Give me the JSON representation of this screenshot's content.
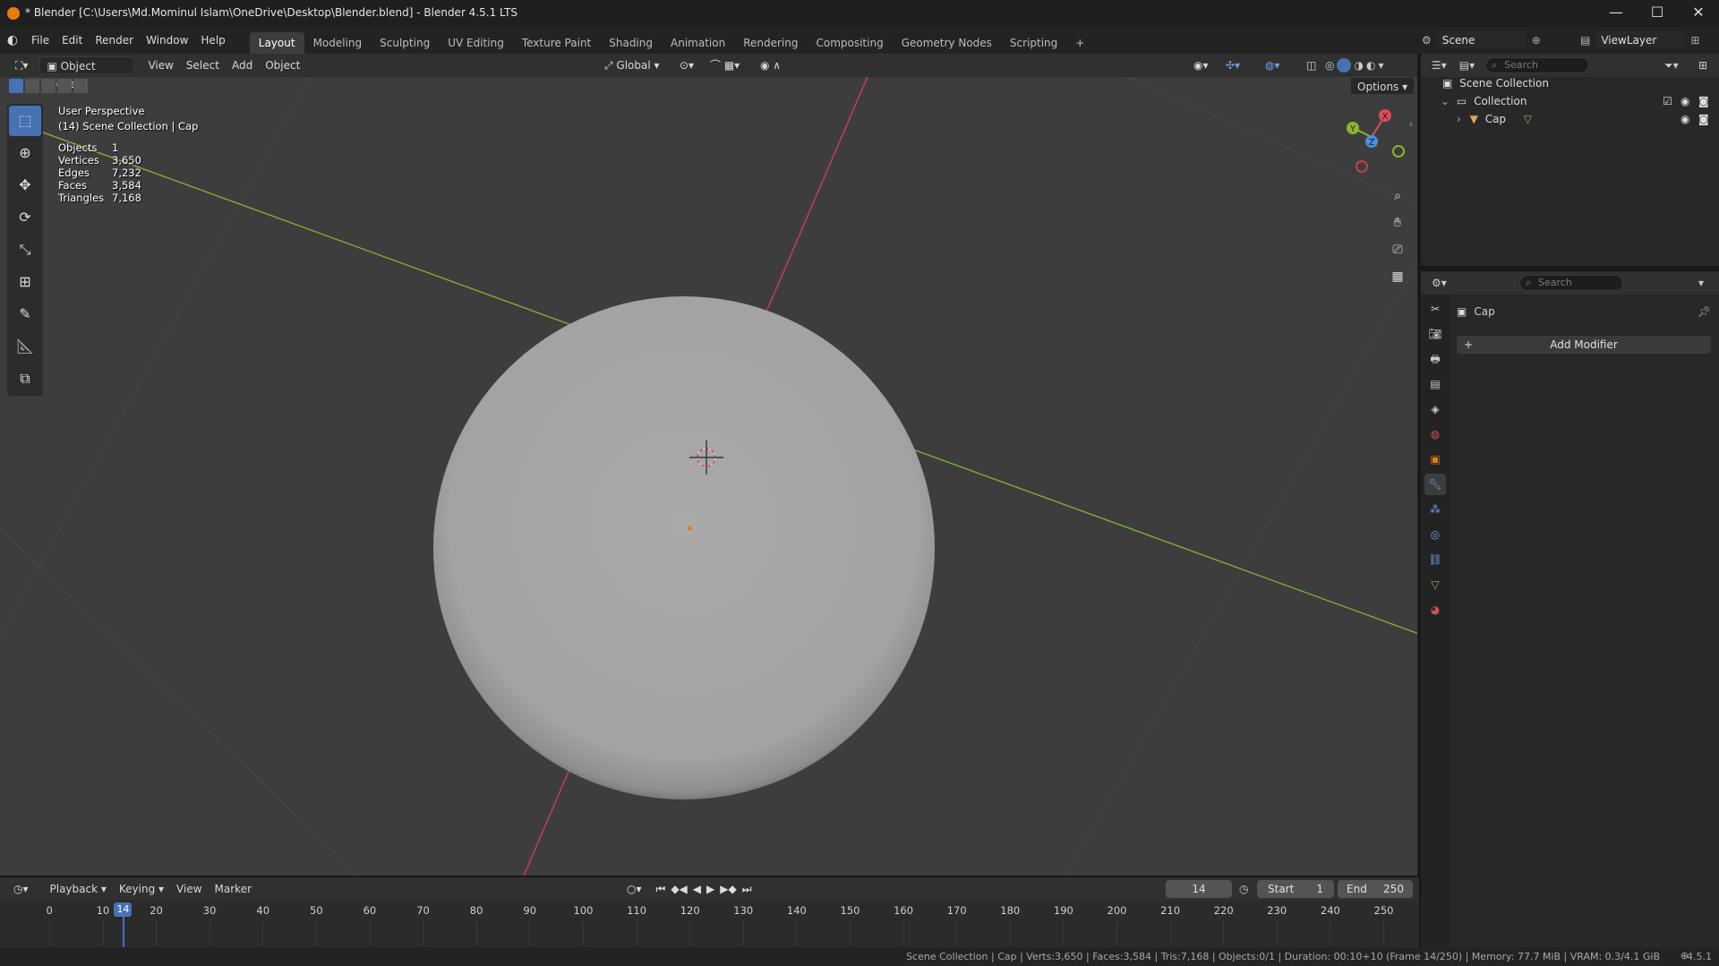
{
  "window": {
    "title": "* Blender [C:\\Users\\Md.Mominul Islam\\OneDrive\\Desktop\\Blender.blend] - Blender 4.5.1 LTS",
    "minimize": "—",
    "maximize": "☐",
    "close": "✕"
  },
  "menu": {
    "items": [
      "File",
      "Edit",
      "Render",
      "Window",
      "Help"
    ]
  },
  "workspaces": {
    "tabs": [
      "Layout",
      "Modeling",
      "Sculpting",
      "UV Editing",
      "Texture Paint",
      "Shading",
      "Animation",
      "Rendering",
      "Compositing",
      "Geometry Nodes",
      "Scripting"
    ],
    "active": "Layout",
    "add": "+"
  },
  "viewport_header": {
    "mode": "Object Mode",
    "menus": [
      "View",
      "Select",
      "Add",
      "Object"
    ],
    "orientation": "Global",
    "options": "Options"
  },
  "viewport_overlay": {
    "perspective": "User Perspective",
    "context": "(14) Scene Collection | Cap",
    "stats": [
      {
        "label": "Objects",
        "value": "1"
      },
      {
        "label": "Vertices",
        "value": "3,650"
      },
      {
        "label": "Edges",
        "value": "7,232"
      },
      {
        "label": "Faces",
        "value": "3,584"
      },
      {
        "label": "Triangles",
        "value": "7,168"
      }
    ],
    "gizmo": {
      "x": "X",
      "y": "Y",
      "z": "Z"
    }
  },
  "topbar_right": {
    "scene": "Scene",
    "view_layer": "ViewLayer"
  },
  "outliner": {
    "search_placeholder": "Search",
    "scene_collection": "Scene Collection",
    "collection": "Collection",
    "object": "Cap"
  },
  "properties": {
    "search_placeholder": "Search",
    "object_name": "Cap",
    "add_modifier": "Add Modifier"
  },
  "timeline": {
    "menus": [
      "Playback",
      "Keying",
      "View",
      "Marker"
    ],
    "current_frame": "14",
    "start_label": "Start",
    "start_value": "1",
    "end_label": "End",
    "end_value": "250",
    "ticks": [
      "0",
      "10",
      "20",
      "30",
      "40",
      "50",
      "60",
      "70",
      "80",
      "90",
      "100",
      "110",
      "120",
      "130",
      "140",
      "150",
      "160",
      "170",
      "180",
      "190",
      "200",
      "210",
      "220",
      "230",
      "240",
      "250"
    ],
    "playhead": "14"
  },
  "statusbar": {
    "text": "Scene Collection | Cap | Verts:3,650 | Faces:3,584 | Tris:7,168 | Objects:0/1 | Duration: 00:10+10 (Frame 14/250) | Memory: 77.7 MiB | VRAM: 0.3/4.1 GiB",
    "version": "4.5.1"
  },
  "colors": {
    "accent": "#4772b3",
    "x_axis": "#e04c56",
    "y_axis": "#8ab62a",
    "z_axis": "#4a8fe0",
    "object_origin": "#e87d0d"
  }
}
